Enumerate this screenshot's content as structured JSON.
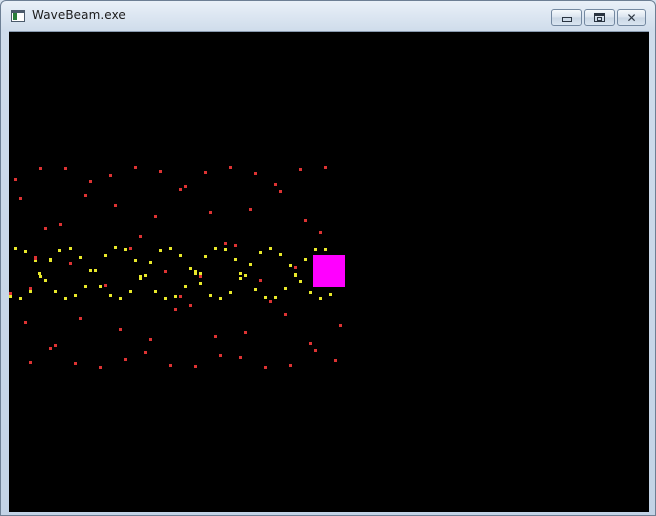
{
  "window": {
    "title": "WaveBeam.exe",
    "icon": "application-window-icon",
    "buttons": {
      "minimize": "minimize-icon",
      "maximize": "restore-icon",
      "close": "close-icon",
      "close_glyph": "✕"
    }
  },
  "game": {
    "background": "#000000",
    "player": {
      "color": "#ff00ff"
    },
    "beam_particle_color": "#e8e82a",
    "wave_particle_color": "#dd3333"
  }
}
